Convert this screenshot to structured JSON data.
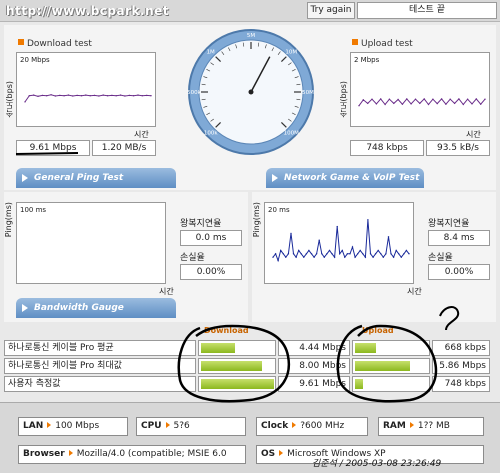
{
  "header": {
    "site_url": "http://www.bcpark.net",
    "try_again": "Try again",
    "test_end": "테스트 끝"
  },
  "download": {
    "title": "Download test",
    "y_label": "속도(bps)",
    "scale": "20 Mbps",
    "x_label": "시간",
    "speed": "9.61 Mbps",
    "rate": "1.20 MB/s",
    "chart_data": {
      "type": "line",
      "ylim": [
        0,
        20
      ],
      "ylabel": "속도(bps)",
      "xlabel": "시간",
      "values": [
        7.5,
        9.6,
        9.8,
        9.4,
        9.7,
        9.6,
        9.9,
        9.5,
        9.7,
        9.6,
        9.8,
        9.5,
        9.7,
        9.6,
        9.8,
        9.6,
        9.7,
        9.5,
        9.8,
        9.6,
        9.7,
        9.6,
        9.8,
        9.5,
        9.7,
        9.6,
        9.8,
        9.6,
        9.7,
        9.6
      ]
    }
  },
  "upload": {
    "title": "Upload test",
    "y_label": "속도(bps)",
    "scale": "2 Mbps",
    "x_label": "시간",
    "speed": "748 kbps",
    "rate": "93.5 kB/s",
    "chart_data": {
      "type": "line",
      "ylim": [
        0,
        2
      ],
      "ylabel": "속도(bps)",
      "xlabel": "시간",
      "values": [
        0.62,
        0.82,
        0.7,
        0.84,
        0.68,
        0.85,
        0.66,
        0.84,
        0.7,
        0.83,
        0.67,
        0.85,
        0.68,
        0.84,
        0.7,
        0.85,
        0.66,
        0.84,
        0.69,
        0.85,
        0.67,
        0.84,
        0.7,
        0.85,
        0.66,
        0.84,
        0.68,
        0.85,
        0.67,
        0.84
      ]
    }
  },
  "gauge": {
    "ticks": [
      "100k",
      "500k",
      "1M",
      "5M",
      "10M",
      "50M",
      "100M"
    ],
    "needle_value": "9.61 Mbps"
  },
  "ping": {
    "tab": "General Ping Test",
    "y_label": "Ping(ms)",
    "scale": "100 ms",
    "x_label": "시간",
    "rtt_label": "왕복지연율",
    "rtt": "0.0 ms",
    "loss_label": "손실율",
    "loss": "0.00%"
  },
  "game": {
    "tab": "Network Game & VoIP Test",
    "y_label": "Ping(ms)",
    "scale": "20 ms",
    "x_label": "시간",
    "rtt_label": "왕복지연율",
    "rtt": "8.4 ms",
    "loss_label": "손실율",
    "loss": "0.00%",
    "chart_data": {
      "type": "line",
      "ylim": [
        0,
        20
      ],
      "ylabel": "Ping(ms)",
      "xlabel": "시간",
      "values": [
        7,
        8,
        6,
        9,
        8,
        7,
        8,
        14,
        8,
        7,
        9,
        8,
        7,
        8,
        9,
        8,
        7,
        8,
        12,
        8,
        7,
        8,
        9,
        8,
        7,
        16,
        8,
        9,
        7,
        8,
        8,
        10,
        7,
        8,
        9,
        8,
        7,
        18,
        8,
        7,
        8,
        9,
        8,
        7,
        8,
        13,
        8,
        7,
        9,
        8,
        7,
        8,
        9,
        8
      ]
    }
  },
  "bandwidth": {
    "tab": "Bandwidth Gauge",
    "download_header": "Download",
    "upload_header": "Upload",
    "rows": [
      {
        "label": "하나로통신 케이블 Pro 평균",
        "download": "4.44 Mbps",
        "upload": "668 kbps",
        "dl_fraction": 0.45,
        "ul_fraction": 0.28
      },
      {
        "label": "하나로통신 케이블 Pro 최대값",
        "download": "8.00 Mbps",
        "upload": "5.86 Mbps",
        "dl_fraction": 0.8,
        "ul_fraction": 0.72
      },
      {
        "label": "사용자 측정값",
        "download": "9.61 Mbps",
        "upload": "748 kbps",
        "dl_fraction": 1.0,
        "ul_fraction": 0.11
      }
    ]
  },
  "system": {
    "lan_label": "LAN",
    "lan": "100 Mbps",
    "cpu_label": "CPU",
    "cpu": "5?6",
    "clock_label": "Clock",
    "clock": "?600 MHz",
    "ram_label": "RAM",
    "ram": "1?? MB",
    "browser_label": "Browser",
    "browser": "Mozilla/4.0 (compatible; MSIE 6.0",
    "os_label": "OS",
    "os": "Microsoft Windows XP"
  },
  "signature": "김준석 / 2005-03-08 23:26:49",
  "colors": {
    "accent": "#f07a00",
    "tab_blue": "#5e8ec4",
    "bar_green": "#9cc629",
    "line_purple": "#6a2d8a",
    "line_blue": "#1a2a9a"
  }
}
